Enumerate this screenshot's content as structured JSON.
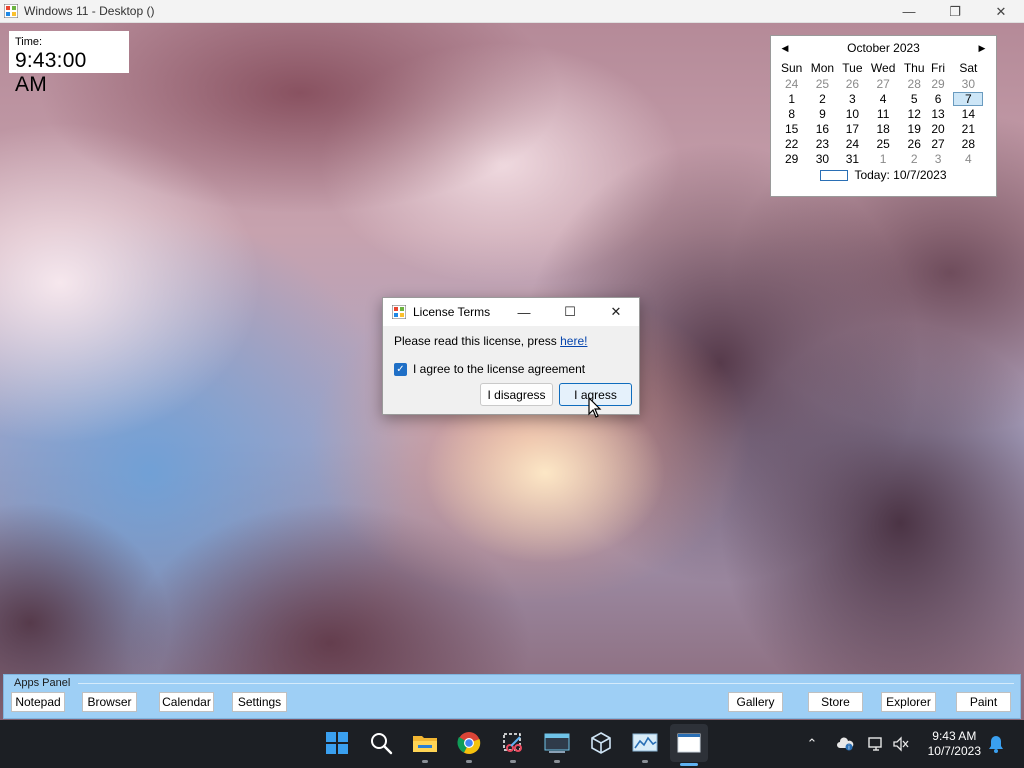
{
  "window": {
    "title": "Windows 11 - Desktop ()",
    "controls": {
      "minimize": "—",
      "restore": "❐",
      "close": "✕"
    }
  },
  "time_widget": {
    "label": "Time:",
    "value": "9:43:00 AM"
  },
  "calendar": {
    "month": "October 2023",
    "prev": "◀",
    "next": "▶",
    "weekdays": [
      "Sun",
      "Mon",
      "Tue",
      "Wed",
      "Thu",
      "Fri",
      "Sat"
    ],
    "weeks": [
      [
        "24",
        "25",
        "26",
        "27",
        "28",
        "29",
        "30"
      ],
      [
        "1",
        "2",
        "3",
        "4",
        "5",
        "6",
        "7"
      ],
      [
        "8",
        "9",
        "10",
        "11",
        "12",
        "13",
        "14"
      ],
      [
        "15",
        "16",
        "17",
        "18",
        "19",
        "20",
        "21"
      ],
      [
        "22",
        "23",
        "24",
        "25",
        "26",
        "27",
        "28"
      ],
      [
        "29",
        "30",
        "31",
        "1",
        "2",
        "3",
        "4"
      ]
    ],
    "selected": "7",
    "today_label": "Today: 10/7/2023"
  },
  "dialog": {
    "title": "License Terms",
    "controls": {
      "minimize": "—",
      "maximize": "☐",
      "close": "✕"
    },
    "message": "Please read this license, press ",
    "link": "here!",
    "checkbox_label": "I agree to the license agreement",
    "checkbox_checked": true,
    "disagree_label": "I disagress",
    "agree_label": "I agress"
  },
  "apps_panel": {
    "label": "Apps Panel",
    "left_buttons": [
      "Notepad",
      "Browser",
      "Calendar",
      "Settings"
    ],
    "right_buttons": [
      "Gallery",
      "Store",
      "Explorer",
      "Paint"
    ]
  },
  "taskbar": {
    "icons": [
      "windows-start-icon",
      "search-icon",
      "file-explorer-icon",
      "chrome-icon",
      "snipping-tool-icon",
      "terminal-icon",
      "virtualbox-icon",
      "task-manager-icon",
      "active-window-icon"
    ],
    "tray": {
      "chevron": "⌃"
    },
    "clock": {
      "time": "9:43 AM",
      "date": "10/7/2023"
    }
  },
  "colors": {
    "accent": "#0f6cbd",
    "apps_panel": "#9ecff5",
    "taskbar": "#1c1f24"
  }
}
